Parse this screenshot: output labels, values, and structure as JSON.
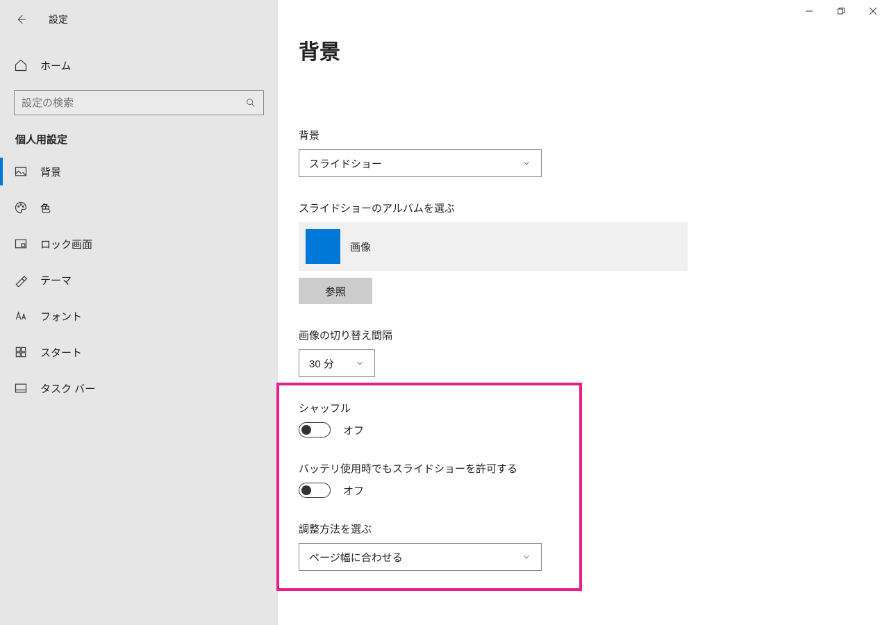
{
  "window": {
    "title": "設定"
  },
  "sidebar": {
    "home": "ホーム",
    "search_placeholder": "設定の検索",
    "category": "個人用設定",
    "items": [
      {
        "label": "背景"
      },
      {
        "label": "色"
      },
      {
        "label": "ロック画面"
      },
      {
        "label": "テーマ"
      },
      {
        "label": "フォント"
      },
      {
        "label": "スタート"
      },
      {
        "label": "タスク バー"
      }
    ]
  },
  "main": {
    "title": "背景",
    "bg_label": "背景",
    "bg_value": "スライドショー",
    "album_label": "スライドショーのアルバムを選ぶ",
    "album_name": "画像",
    "browse": "参照",
    "interval_label": "画像の切り替え間隔",
    "interval_value": "30 分",
    "shuffle_label": "シャッフル",
    "shuffle_state": "オフ",
    "battery_label": "バッテリ使用時でもスライドショーを許可する",
    "battery_state": "オフ",
    "fit_label": "調整方法を選ぶ",
    "fit_value": "ページ幅に合わせる"
  }
}
